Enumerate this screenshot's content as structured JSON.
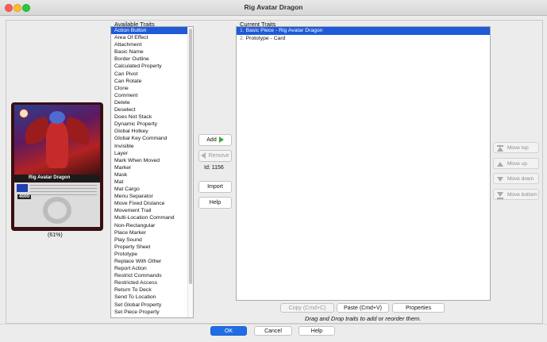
{
  "window": {
    "title": "Rig Avatar Dragon"
  },
  "card": {
    "name": "Rig Avatar Dragon",
    "bp": "4000",
    "zoom": "(61%)"
  },
  "available_traits": {
    "label": "Available Traits",
    "items": [
      "Action Button",
      "Area Of Effect",
      "Attachment",
      "Basic Name",
      "Border Outline",
      "Calculated Property",
      "Can Pivot",
      "Can Rotate",
      "Clone",
      "Comment",
      "Delete",
      "Deselect",
      "Does Not Stack",
      "Dynamic Property",
      "Global Hotkey",
      "Global Key Command",
      "Invisible",
      "Layer",
      "Mark When Moved",
      "Marker",
      "Mask",
      "Mat",
      "Mat Cargo",
      "Menu Separator",
      "Move Fixed Distance",
      "Movement Trail",
      "Multi-Location Command",
      "Non-Rectangular",
      "Place Marker",
      "Play Sound",
      "Property Sheet",
      "Prototype",
      "Replace With Other",
      "Report Action",
      "Restrict Commands",
      "Restricted Access",
      "Return To Deck",
      "Send To Location",
      "Set Global Property",
      "Set Piece Property"
    ],
    "selected_index": 0
  },
  "middle": {
    "add_label": "Add",
    "remove_label": "Remove",
    "id_label": "Id: 1156",
    "import_label": "Import",
    "help_label": "Help"
  },
  "current_traits": {
    "label": "Current Traits",
    "items": [
      {
        "num": "1.",
        "text": "Basic Piece - Rig Avatar Dragon"
      },
      {
        "num": "2.",
        "text": "Prototype - Card"
      }
    ],
    "selected_index": 0
  },
  "move_buttons": {
    "top": "Move top",
    "up": "Move up",
    "down": "Move down",
    "bottom": "Move bottom"
  },
  "lower_buttons": {
    "copy": "Copy (Cmd+C)",
    "paste": "Paste (Cmd+V)",
    "properties": "Properties"
  },
  "hint": "Drag and Drop traits to add or reorder them.",
  "dialog_buttons": {
    "ok": "OK",
    "cancel": "Cancel",
    "help": "Help"
  },
  "colors": {
    "selection": "#1f5ad8",
    "ok_button": "#1f6ee8",
    "add_arrow": "#3aa93a"
  }
}
